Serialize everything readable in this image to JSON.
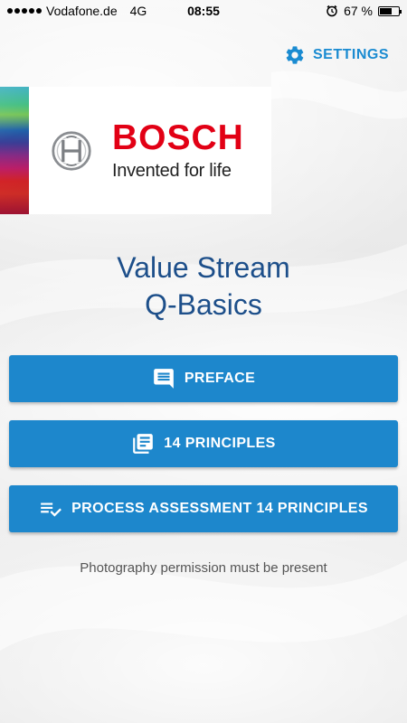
{
  "status_bar": {
    "carrier": "Vodafone.de",
    "network": "4G",
    "time": "08:55",
    "battery_text": "67 %",
    "battery_level": 0.67,
    "alarm_icon": "alarm-icon"
  },
  "settings": {
    "label": "SETTINGS",
    "icon": "gear-icon"
  },
  "logo": {
    "brand": "BOSCH",
    "slogan": "Invented for life"
  },
  "title": {
    "line1": "Value Stream",
    "line2": "Q-Basics"
  },
  "buttons": {
    "preface": {
      "label": "PREFACE",
      "icon": "comment-icon"
    },
    "principles": {
      "label": "14 PRINCIPLES",
      "icon": "library-books-icon"
    },
    "assessment": {
      "label": "PROCESS ASSESSMENT 14 PRINCIPLES",
      "icon": "checklist-icon"
    }
  },
  "note": "Photography permission must be present",
  "colors": {
    "accent": "#1d87cc",
    "settings": "#1a8bd1",
    "title": "#1d4f8a",
    "brand_red": "#e20015"
  }
}
